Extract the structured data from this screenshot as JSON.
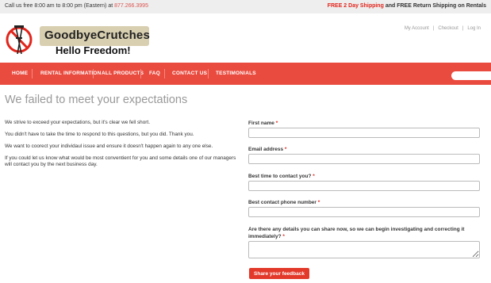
{
  "topbar": {
    "call_text": "Call us free 8:00 am to 8:00 pm (Eastern) at",
    "phone": "877.266.3995",
    "promo_highlight": "FREE 2 Day Shipping",
    "promo_rest": "and FREE Return Shipping on Rentals"
  },
  "header": {
    "logo_title": "GoodbyeCrutches",
    "logo_subtitle": "Hello Freedom!",
    "account_links": [
      "My Account",
      "Checkout",
      "Log In"
    ],
    "separator": "|"
  },
  "nav": {
    "items": [
      "Home",
      "Rental Information",
      "All Products",
      "FAQ",
      "Contact Us",
      "Testimonials"
    ]
  },
  "main": {
    "title": "We failed to meet your expectations",
    "paragraphs": [
      "We strive to exceed your expectations, but it's clear we fell short.",
      "You didn't have to take the time to respond to this questions, but you did.  Thank you.",
      "We want to coorect your individaul issue and ensure it doesn't happen again to any one else.",
      "If you could let us know what would be most conventient for you and some details one of our managers will contact you by the next business day."
    ]
  },
  "form": {
    "first_name_label": "First name",
    "email_label": "Email address",
    "best_time_label": "Best time to contact you?",
    "phone_label": "Best contact phone number",
    "details_label": "Are there any details you can share now, so we can begin investigating and correcting it immediately?",
    "required_mark": "*",
    "submit_label": "Share your feedback"
  },
  "colors": {
    "nav_bg": "#ea4b3f",
    "accent_red": "#e2241b",
    "logo_badge": "#d8ceb0",
    "title_gray": "#999999"
  },
  "icons": [
    "no-crutches-logo-icon"
  ]
}
